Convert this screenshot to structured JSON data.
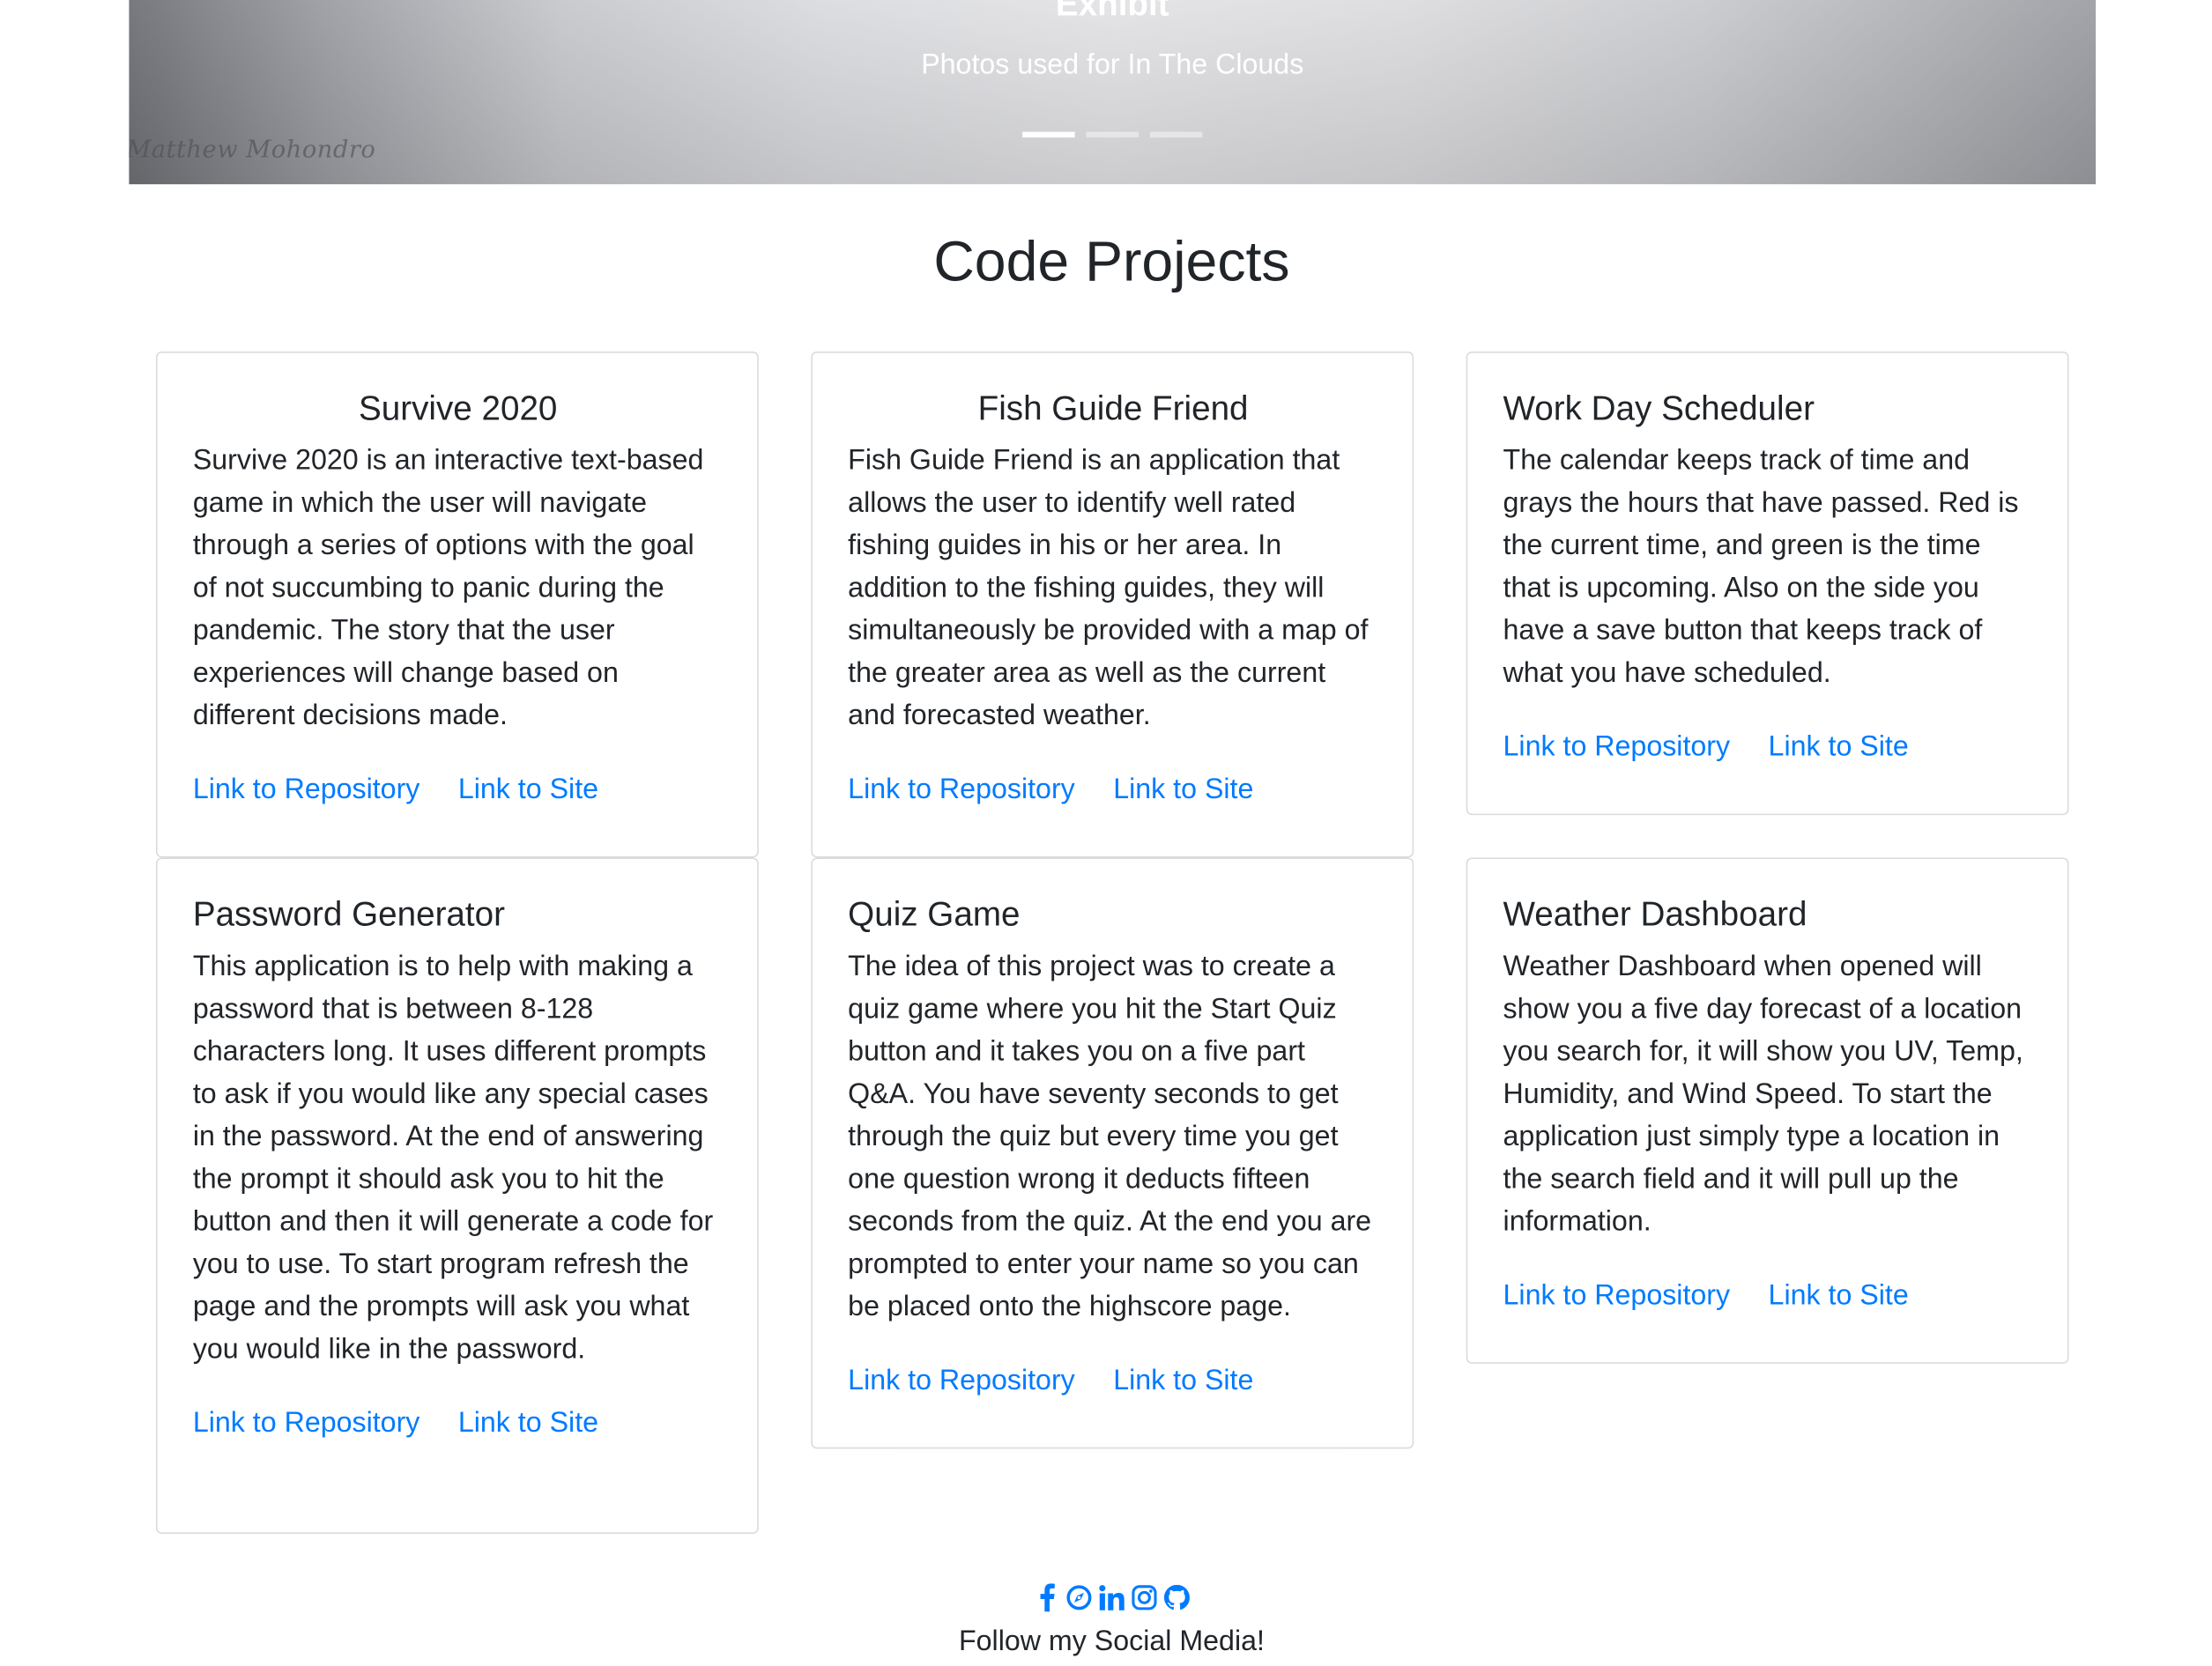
{
  "carousel": {
    "title": "Exhibit",
    "subtitle": "Photos used for In The Clouds",
    "signature": "Matthew Mohondro",
    "indicator_count": 3,
    "active_index": 0
  },
  "section": {
    "title": "Code Projects"
  },
  "projects": [
    {
      "title": "Survive 2020",
      "description": "Survive 2020 is an interactive text-based game in which the user will navigate through a series of options with the goal of not succumbing to panic during the pandemic. The story that the user experiences will change based on different decisions made.",
      "repo_label": "Link to Repository",
      "site_label": "Link to Site"
    },
    {
      "title": "Fish Guide Friend",
      "description": "Fish Guide Friend is an application that allows the user to identify well rated fishing guides in his or her area. In addition to the fishing guides, they will simultaneously be provided with a map of the greater area as well as the current and forecasted weather.",
      "repo_label": "Link to Repository",
      "site_label": "Link to Site"
    },
    {
      "title": "Work Day Scheduler",
      "description": "The calendar keeps track of time and grays the hours that have passed. Red is the current time, and green is the time that is upcoming. Also on the side you have a save button that keeps track of what you have scheduled.",
      "repo_label": "Link to Repository",
      "site_label": "Link to Site"
    },
    {
      "title": "Password Generator",
      "description": "This application is to help with making a password that is between 8-128 characters long. It uses different prompts to ask if you would like any special cases in the password. At the end of answering the prompt it should ask you to hit the button and then it will generate a code for you to use. To start program refresh the page and the prompts will ask you what you would like in the password.",
      "repo_label": "Link to Repository",
      "site_label": "Link to Site"
    },
    {
      "title": "Quiz Game",
      "description": "The idea of this project was to create a quiz game where you hit the Start Quiz button and it takes you on a five part Q&A. You have seventy seconds to get through the quiz but every time you get one question wrong it deducts fifteen seconds from the quiz. At the end you are prompted to enter your name so you can be placed onto the highscore page.",
      "repo_label": "Link to Repository",
      "site_label": "Link to Site"
    },
    {
      "title": "Weather Dashboard",
      "description": "Weather Dashboard when opened will show you a five day forecast of a location you search for, it will show you UV, Temp, Humidity, and Wind Speed. To start the application just simply type a location in the search field and it will pull up the information.",
      "repo_label": "Link to Repository",
      "site_label": "Link to Site"
    }
  ],
  "footer": {
    "social_icons": [
      "facebook-icon",
      "portfolio-compass-icon",
      "linkedin-icon",
      "instagram-icon",
      "github-icon"
    ],
    "icon_color": "#007bff",
    "follow_text": "Follow my Social Media!"
  },
  "colors": {
    "link": "#007bff",
    "text": "#212529"
  }
}
